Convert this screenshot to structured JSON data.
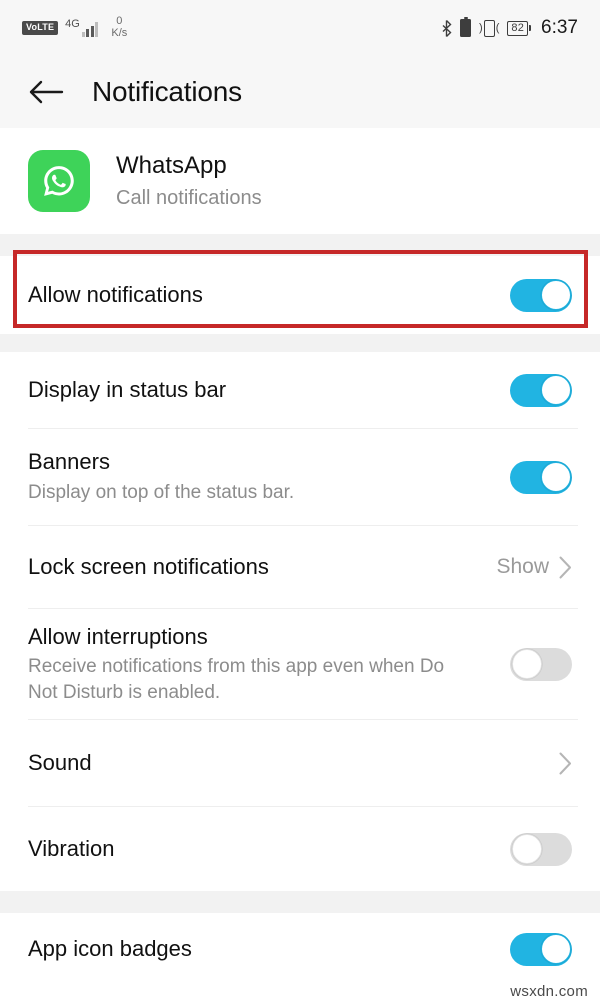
{
  "status_bar": {
    "volte_label": "VoLTE",
    "network_generation": "4G",
    "data_speed_value": "0",
    "data_speed_unit": "K/s",
    "bluetooth_icon": "bluetooth-icon",
    "battery_icon": "battery-icon",
    "vibrate_icon": "vibrate-mode-icon",
    "battery_percent": "82",
    "time": "6:37"
  },
  "app_bar": {
    "back_icon": "back-arrow-icon",
    "title": "Notifications"
  },
  "app_header": {
    "icon": "whatsapp-icon",
    "name": "WhatsApp",
    "subtitle": "Call notifications"
  },
  "settings": {
    "allow_notifications": {
      "title": "Allow notifications",
      "toggle_state": "on"
    },
    "rows": [
      {
        "title": "Display in status bar",
        "subtitle": "",
        "control": "toggle",
        "toggle_state": "on",
        "value": ""
      },
      {
        "title": "Banners",
        "subtitle": "Display on top of the status bar.",
        "control": "toggle",
        "toggle_state": "on",
        "value": ""
      },
      {
        "title": "Lock screen notifications",
        "subtitle": "",
        "control": "chevron",
        "toggle_state": "",
        "value": "Show"
      },
      {
        "title": "Allow interruptions",
        "subtitle": "Receive notifications from this app even when Do Not Disturb is enabled.",
        "control": "toggle",
        "toggle_state": "off",
        "value": ""
      },
      {
        "title": "Sound",
        "subtitle": "",
        "control": "chevron",
        "toggle_state": "",
        "value": ""
      },
      {
        "title": "Vibration",
        "subtitle": "",
        "control": "toggle",
        "toggle_state": "off",
        "value": ""
      }
    ],
    "badges_row": {
      "title": "App icon badges",
      "toggle_state": "on"
    }
  },
  "annotation": {
    "highlight_target": "allow-notifications-row",
    "color": "#c62828"
  },
  "watermark": {
    "text": "wsxdn.com"
  },
  "colors": {
    "toggle_on": "#21b4e2",
    "toggle_off": "#dcdcdc",
    "app_icon_green": "#3ed359",
    "section_gap": "#f2f2f2",
    "status_bar_bg": "#f7f7f7",
    "secondary_text": "#8c8c8c"
  }
}
